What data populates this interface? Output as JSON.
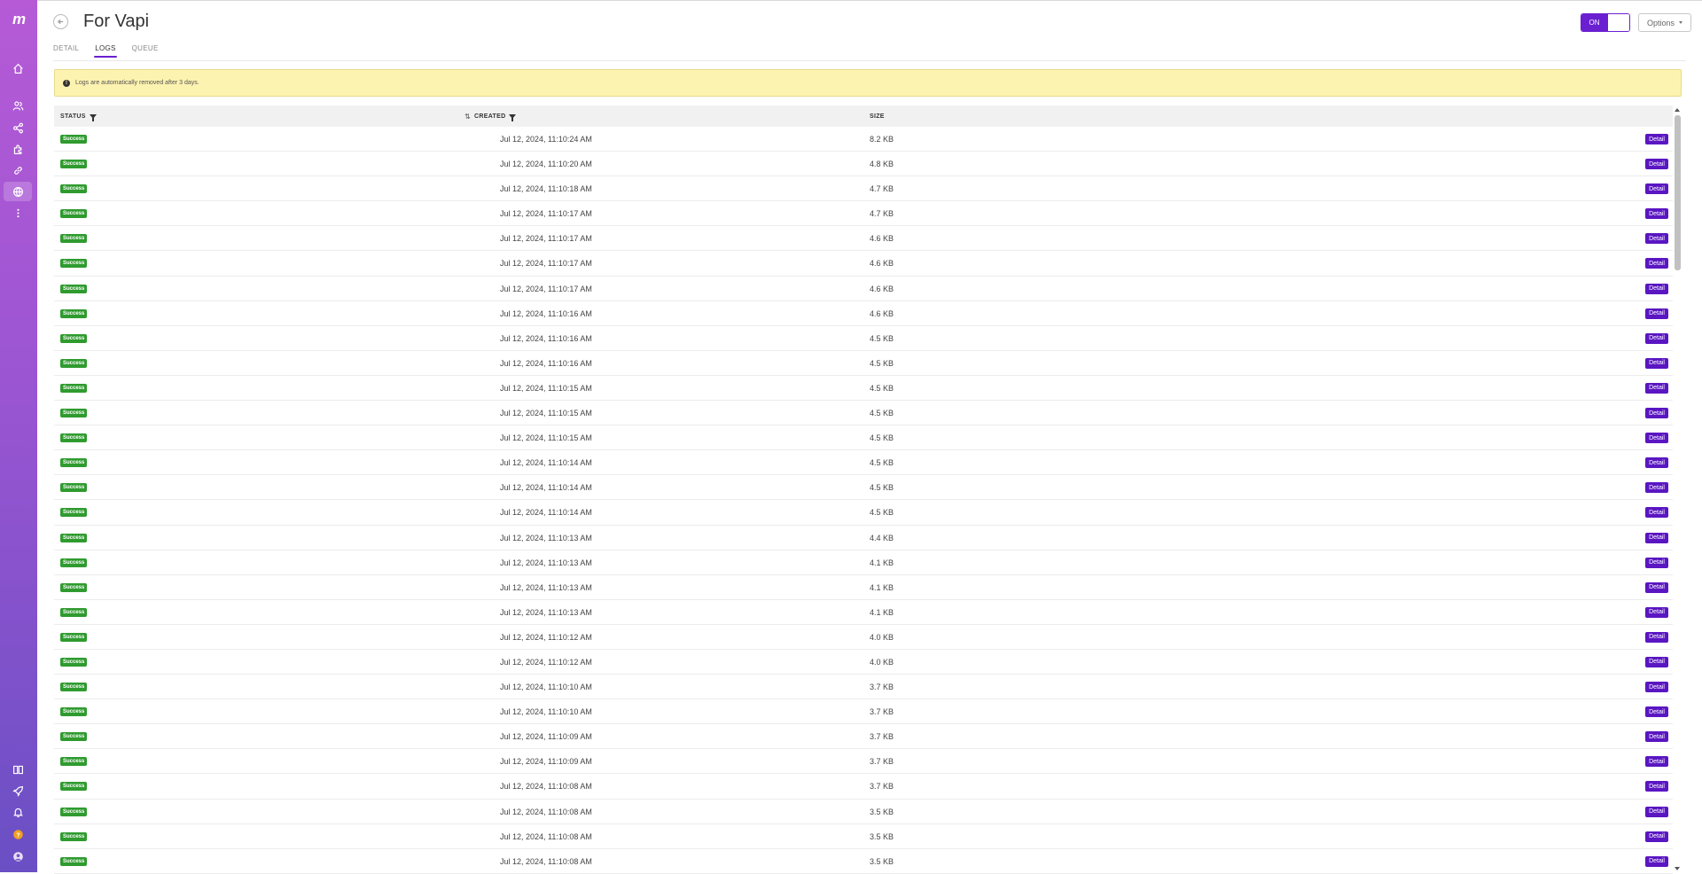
{
  "sidebar": {
    "logo": "m",
    "items": [
      {
        "icon": "home-icon",
        "active": false
      },
      {
        "icon": "users-icon",
        "active": false
      },
      {
        "icon": "share-icon",
        "active": false
      },
      {
        "icon": "puzzle-icon",
        "active": false
      },
      {
        "icon": "link-icon",
        "active": false
      },
      {
        "icon": "globe-icon",
        "active": true
      },
      {
        "icon": "more-vertical-icon",
        "active": false
      }
    ],
    "bottom_items": [
      {
        "icon": "book-icon"
      },
      {
        "icon": "rocket-icon"
      },
      {
        "icon": "bell-icon"
      },
      {
        "icon": "help-icon",
        "color": "#f0a020"
      },
      {
        "icon": "user-avatar-icon"
      }
    ]
  },
  "header": {
    "title": "For Vapi",
    "tabs": [
      {
        "label": "DETAIL",
        "active": false
      },
      {
        "label": "LOGS",
        "active": true
      },
      {
        "label": "QUEUE",
        "active": false
      }
    ],
    "toggle": {
      "label": "ON",
      "state": true
    },
    "options_label": "Options"
  },
  "banner": {
    "text": "Logs are automatically removed after 3 days."
  },
  "table": {
    "columns": {
      "status": "STATUS",
      "created": "CREATED",
      "size": "SIZE"
    },
    "detail_label": "Detail",
    "rows": [
      {
        "status": "Success",
        "created": "Jul 12, 2024, 11:10:24 AM",
        "size": "8.2 KB"
      },
      {
        "status": "Success",
        "created": "Jul 12, 2024, 11:10:20 AM",
        "size": "4.8 KB"
      },
      {
        "status": "Success",
        "created": "Jul 12, 2024, 11:10:18 AM",
        "size": "4.7 KB"
      },
      {
        "status": "Success",
        "created": "Jul 12, 2024, 11:10:17 AM",
        "size": "4.7 KB"
      },
      {
        "status": "Success",
        "created": "Jul 12, 2024, 11:10:17 AM",
        "size": "4.6 KB"
      },
      {
        "status": "Success",
        "created": "Jul 12, 2024, 11:10:17 AM",
        "size": "4.6 KB"
      },
      {
        "status": "Success",
        "created": "Jul 12, 2024, 11:10:17 AM",
        "size": "4.6 KB"
      },
      {
        "status": "Success",
        "created": "Jul 12, 2024, 11:10:16 AM",
        "size": "4.6 KB"
      },
      {
        "status": "Success",
        "created": "Jul 12, 2024, 11:10:16 AM",
        "size": "4.5 KB"
      },
      {
        "status": "Success",
        "created": "Jul 12, 2024, 11:10:16 AM",
        "size": "4.5 KB"
      },
      {
        "status": "Success",
        "created": "Jul 12, 2024, 11:10:15 AM",
        "size": "4.5 KB"
      },
      {
        "status": "Success",
        "created": "Jul 12, 2024, 11:10:15 AM",
        "size": "4.5 KB"
      },
      {
        "status": "Success",
        "created": "Jul 12, 2024, 11:10:15 AM",
        "size": "4.5 KB"
      },
      {
        "status": "Success",
        "created": "Jul 12, 2024, 11:10:14 AM",
        "size": "4.5 KB"
      },
      {
        "status": "Success",
        "created": "Jul 12, 2024, 11:10:14 AM",
        "size": "4.5 KB"
      },
      {
        "status": "Success",
        "created": "Jul 12, 2024, 11:10:14 AM",
        "size": "4.5 KB"
      },
      {
        "status": "Success",
        "created": "Jul 12, 2024, 11:10:13 AM",
        "size": "4.4 KB"
      },
      {
        "status": "Success",
        "created": "Jul 12, 2024, 11:10:13 AM",
        "size": "4.1 KB"
      },
      {
        "status": "Success",
        "created": "Jul 12, 2024, 11:10:13 AM",
        "size": "4.1 KB"
      },
      {
        "status": "Success",
        "created": "Jul 12, 2024, 11:10:13 AM",
        "size": "4.1 KB"
      },
      {
        "status": "Success",
        "created": "Jul 12, 2024, 11:10:12 AM",
        "size": "4.0 KB"
      },
      {
        "status": "Success",
        "created": "Jul 12, 2024, 11:10:12 AM",
        "size": "4.0 KB"
      },
      {
        "status": "Success",
        "created": "Jul 12, 2024, 11:10:10 AM",
        "size": "3.7 KB"
      },
      {
        "status": "Success",
        "created": "Jul 12, 2024, 11:10:10 AM",
        "size": "3.7 KB"
      },
      {
        "status": "Success",
        "created": "Jul 12, 2024, 11:10:09 AM",
        "size": "3.7 KB"
      },
      {
        "status": "Success",
        "created": "Jul 12, 2024, 11:10:09 AM",
        "size": "3.7 KB"
      },
      {
        "status": "Success",
        "created": "Jul 12, 2024, 11:10:08 AM",
        "size": "3.7 KB"
      },
      {
        "status": "Success",
        "created": "Jul 12, 2024, 11:10:08 AM",
        "size": "3.5 KB"
      },
      {
        "status": "Success",
        "created": "Jul 12, 2024, 11:10:08 AM",
        "size": "3.5 KB"
      },
      {
        "status": "Success",
        "created": "Jul 12, 2024, 11:10:08 AM",
        "size": "3.5 KB"
      }
    ]
  },
  "colors": {
    "accent": "#6a1fd0",
    "success": "#2f9b2f",
    "banner": "#fdf3b0"
  }
}
